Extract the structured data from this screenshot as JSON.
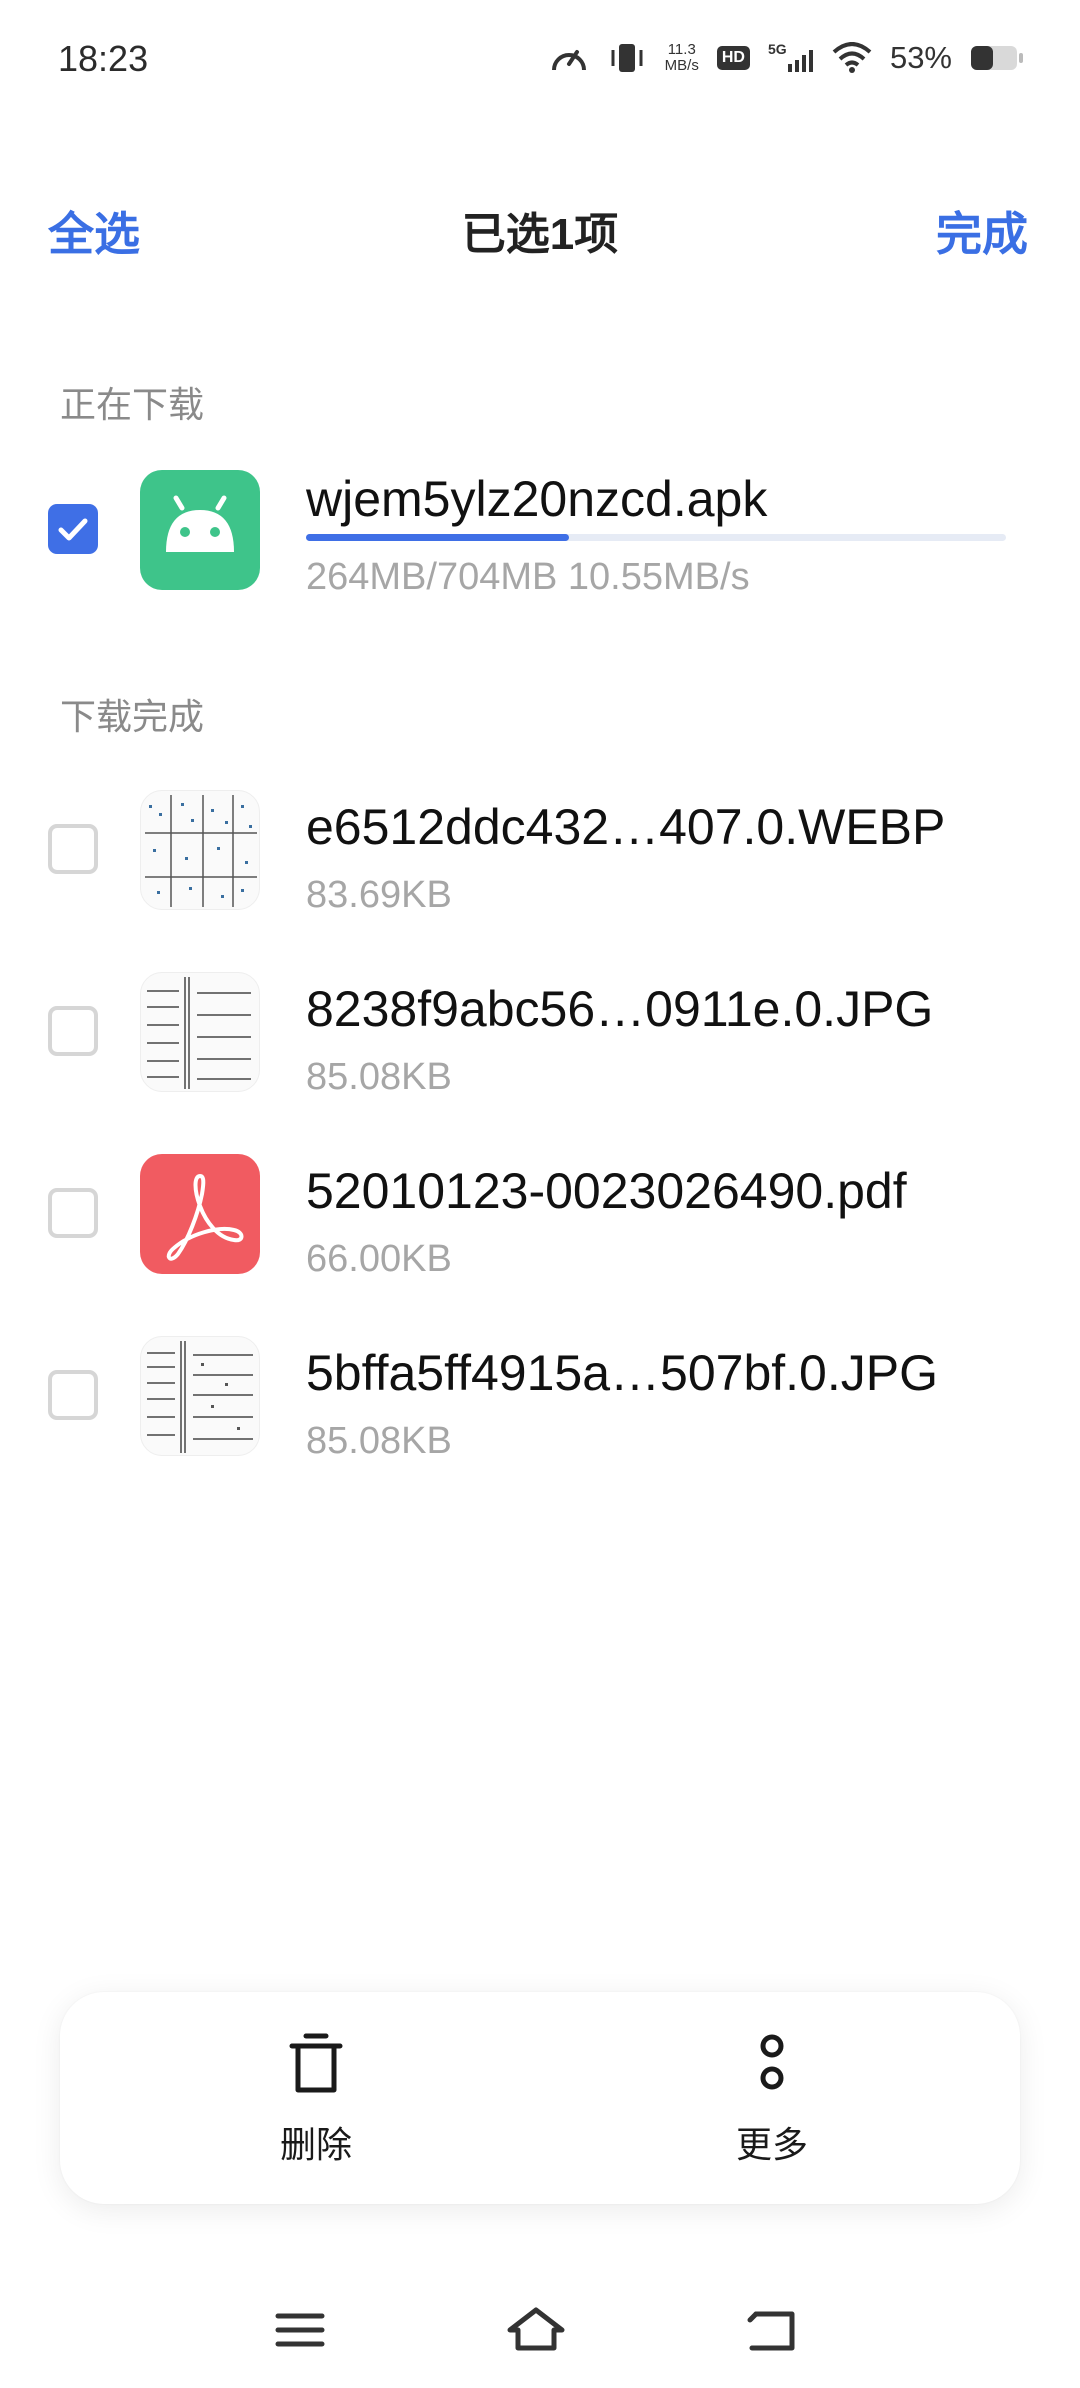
{
  "status_bar": {
    "time": "18:23",
    "net_speed_value": "11.3",
    "net_speed_unit": "MB/s",
    "hd": "HD",
    "signal": "5G",
    "battery": "53%"
  },
  "header": {
    "select_all": "全选",
    "title": "已选1项",
    "done": "完成"
  },
  "sections": {
    "downloading": "正在下载",
    "completed": "下载完成"
  },
  "downloading": {
    "name": "wjem5ylz20nzcd.apk",
    "size_text": "264MB/704MB  10.55MB/s",
    "progress": 0.375,
    "checked": true
  },
  "completed": [
    {
      "name": "e6512ddc432…407.0.WEBP",
      "size": "83.69KB",
      "checked": false,
      "type": "image"
    },
    {
      "name": "8238f9abc56…0911e.0.JPG",
      "size": "85.08KB",
      "checked": false,
      "type": "image"
    },
    {
      "name": "52010123-0023026490.pdf",
      "size": "66.00KB",
      "checked": false,
      "type": "pdf"
    },
    {
      "name": "5bffa5ff4915a…507bf.0.JPG",
      "size": "85.08KB",
      "checked": false,
      "type": "image"
    }
  ],
  "actions": {
    "delete": "删除",
    "more": "更多"
  },
  "colors": {
    "accent": "#3f6fe6",
    "apk": "#3ec48a",
    "pdf": "#f15b61"
  }
}
